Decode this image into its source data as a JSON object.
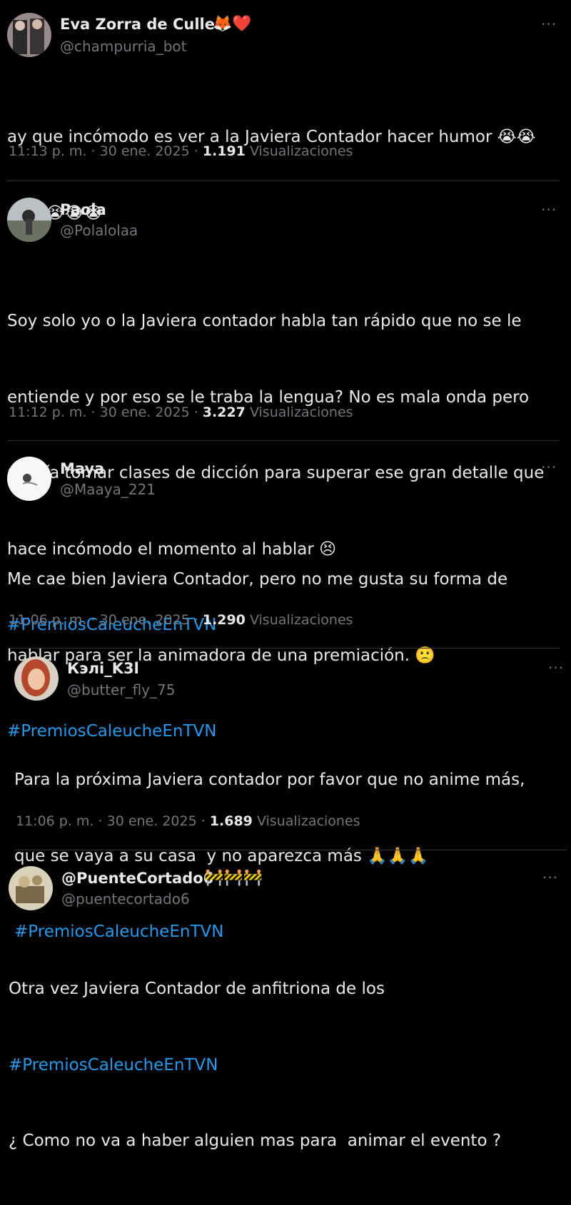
{
  "tweets": [
    {
      "name": "Eva Zorra de Cullen",
      "name_emoji": "🦊❤️",
      "handle": "@champurria_bot",
      "text_line1": "ay que incómodo es ver a la Javiera Contador hacer humor 😭😭",
      "text_line2": "😭😭😭😭😭",
      "time": "11:13 p. m. · 30 ene. 2025 · ",
      "views": "1.191",
      "views_label": " Visualizaciones",
      "more": "···"
    },
    {
      "name": "Paola",
      "handle": "@Polalolaa",
      "text_line1": "Soy solo yo o la Javiera contador habla tan rápido que no se le",
      "text_line2": "entiende y por eso se le traba la lengua? No es mala onda pero",
      "text_line3": "podría tomar clases de dicción para superar ese gran detalle que",
      "text_line4": "hace incómodo el momento al hablar 😣",
      "hashtag": "#PremiosCaleucheEnTVN",
      "time": "11:12 p. m. · 30 ene. 2025 · ",
      "views": "3.227",
      "views_label": " Visualizaciones",
      "more": "···"
    },
    {
      "name": "Maya",
      "handle": "@Maaya_221",
      "text_line1": "Me cae bien Javiera Contador, pero no me gusta su forma de",
      "text_line2": "hablar para ser la animadora de una premiación. 🙁",
      "hashtag": "#PremiosCaleucheEnTVN",
      "time": "11:06 p. m. · 30 ene. 2025 · ",
      "views": "1.290",
      "views_label": " Visualizaciones",
      "more": "···"
    },
    {
      "name": "Кэлі_K3l",
      "handle": "@butter_fly_75",
      "text_line1": "Para la próxima Javiera contador por favor que no anime más,",
      "text_line2": "que se vaya a su casa  y no aparezca más 🙏🙏🙏",
      "hashtag": "#PremiosCaleucheEnTVN",
      "time": "11:06 p. m. · 30 ene. 2025 · ",
      "views": "1.689",
      "views_label": " Visualizaciones",
      "more": "···"
    },
    {
      "name": "@PuenteCortado6",
      "name_emoji": "🚧🚧🚧",
      "handle": "@puentecortado6",
      "text_line1": "Otra vez Javiera Contador de anfitriona de los",
      "hashtag": "#PremiosCaleucheEnTVN",
      "text_line3": "¿ Como no va a haber alguien mas para  animar el evento ?",
      "more": "···"
    }
  ],
  "colors": {
    "background": "#000000",
    "text": "#e7e9ea",
    "muted": "#71767b",
    "link": "#1d9bf0",
    "separator": "#2f3336"
  }
}
